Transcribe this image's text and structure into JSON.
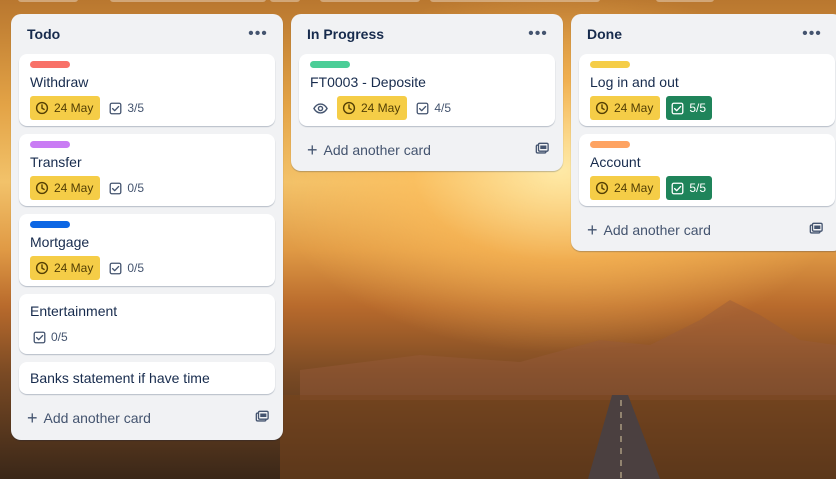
{
  "colors": {
    "label_red": "#f87168",
    "label_purple": "#c97cf4",
    "label_blue": "#0c66e4",
    "label_green": "#4bce97",
    "label_yellow": "#f5cd47",
    "label_orange": "#fea362",
    "date_badge": "#f5cd47",
    "complete_badge": "#1f845a"
  },
  "add_card_label": "Add another card",
  "lists": [
    {
      "title": "Todo",
      "menu_icon": "more-horizontal-icon",
      "cards": [
        {
          "title": "Withdraw",
          "label_color": "label_red",
          "date": "24 May",
          "checklist": "3/5",
          "complete": false
        },
        {
          "title": "Transfer",
          "label_color": "label_purple",
          "date": "24 May",
          "checklist": "0/5",
          "complete": false
        },
        {
          "title": "Mortgage",
          "label_color": "label_blue",
          "date": "24 May",
          "checklist": "0/5",
          "complete": false
        },
        {
          "title": "Entertainment",
          "checklist": "0/5",
          "complete": false
        },
        {
          "title": "Banks statement if have time"
        }
      ]
    },
    {
      "title": "In Progress",
      "menu_icon": "more-horizontal-icon",
      "cards": [
        {
          "title": "FT0003 - Deposite",
          "label_color": "label_green",
          "watching": true,
          "date": "24 May",
          "checklist": "4/5",
          "complete": false
        }
      ]
    },
    {
      "title": "Done",
      "menu_icon": "more-horizontal-icon",
      "cards": [
        {
          "title": "Log in and out",
          "label_color": "label_yellow",
          "date": "24 May",
          "checklist": "5/5",
          "complete": true
        },
        {
          "title": "Account",
          "label_color": "label_orange",
          "date": "24 May",
          "checklist": "5/5",
          "complete": true
        }
      ]
    }
  ]
}
